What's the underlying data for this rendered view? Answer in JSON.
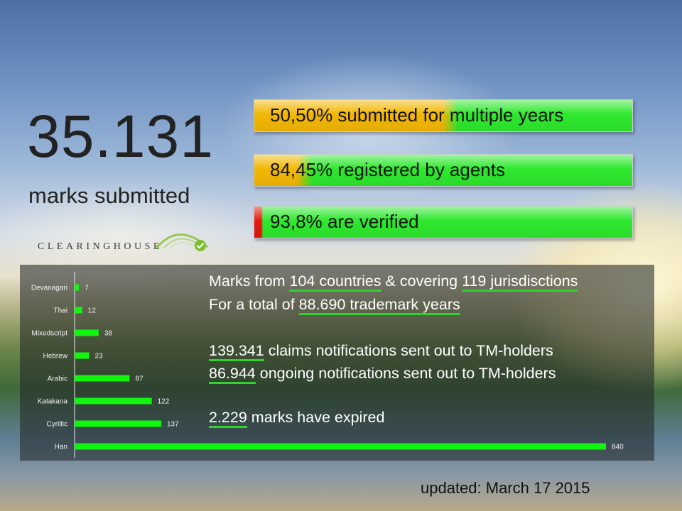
{
  "headline": {
    "number": "35.131",
    "caption": "marks submitted"
  },
  "logo": {
    "text": "CLEARINGHOUSE",
    "check_icon": "check-icon"
  },
  "stats": [
    {
      "label": "50,50% submitted for multiple years",
      "percent": 50.5,
      "tab_color": "#f2b705"
    },
    {
      "label": "84,45% registered by agents",
      "percent": 84.45,
      "tab_color": "#f2b705"
    },
    {
      "label": "93,8% are verified",
      "percent": 93.8,
      "tab_color": "#e11b0e"
    }
  ],
  "info": {
    "line1": {
      "pre": "Marks from ",
      "countries": "104 countries",
      "mid": " & covering ",
      "jurisdictions": "119 jurisdisctions"
    },
    "line2": {
      "pre": "For a total of ",
      "years": "88.690 trademark years"
    },
    "line3": {
      "num": "139.341",
      "text": " claims notifications sent out to TM-holders"
    },
    "line4": {
      "num": "86.944",
      "text": " ongoing notifications sent out to TM-holders"
    },
    "line5": {
      "num": "2.229",
      "text": " marks have expired"
    }
  },
  "updated": "updated: March 17 2015",
  "colors": {
    "bar_green": "#11f511",
    "underline_green": "#2fd22f",
    "stat_green": "#2ee82e"
  },
  "chart_data": {
    "type": "bar",
    "orientation": "horizontal",
    "categories": [
      "Devanagari",
      "Thai",
      "Mixedscript",
      "Hebrew",
      "Arabic",
      "Katakana",
      "Cyrillic",
      "Han"
    ],
    "values": [
      7,
      12,
      38,
      23,
      87,
      122,
      137,
      840
    ],
    "data_labels": true,
    "title": "",
    "xlabel": "",
    "ylabel": "",
    "xlim": [
      0,
      840
    ],
    "grid": false,
    "legend": "none"
  }
}
